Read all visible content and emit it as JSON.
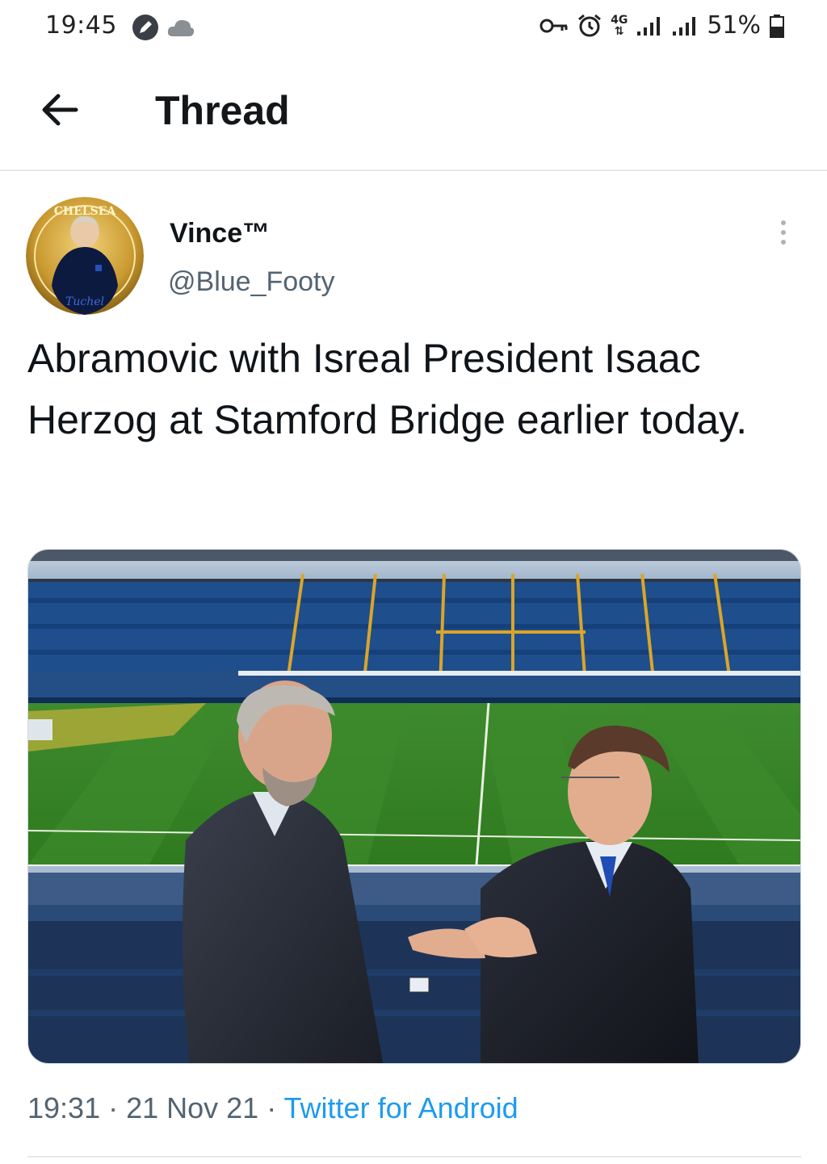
{
  "status_bar": {
    "time": "19:45",
    "network": "4G",
    "battery": "51%",
    "icons": [
      "edit-badge-icon",
      "cloud-icon",
      "key-icon",
      "alarm-icon",
      "network-4g-icon",
      "signal-icon",
      "signal-icon",
      "battery-icon"
    ]
  },
  "header": {
    "title": "Thread",
    "back_icon": "back-arrow-icon"
  },
  "tweet": {
    "display_name": "Vince™",
    "handle": "@Blue_Footy",
    "text": "Abramovic with Isreal President Isaac Herzog at Stamford Bridge earlier today.",
    "avatar_badge_text": "CHELSEA",
    "avatar_caption": "Tuchel",
    "time": "19:31",
    "date": "21 Nov 21",
    "source": "Twitter for Android",
    "separator": " · "
  },
  "colors": {
    "accent": "#1d9bf0",
    "text_primary": "#0f1419",
    "text_secondary": "#536471",
    "divider": "#e6e8ea"
  }
}
